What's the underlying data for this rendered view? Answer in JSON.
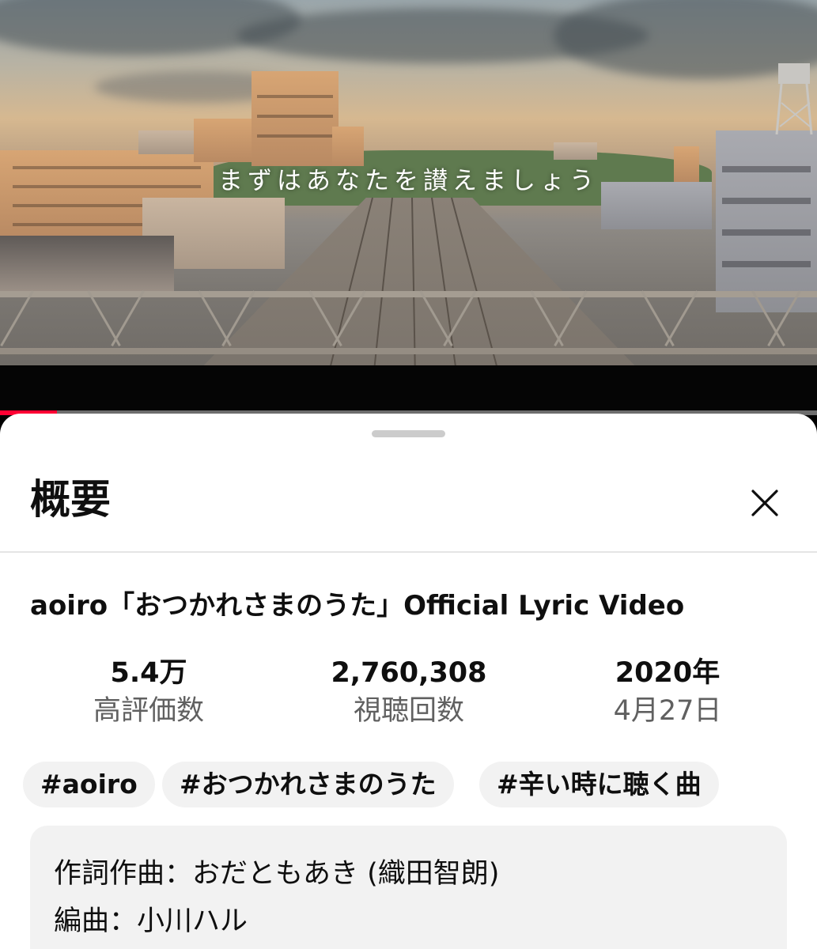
{
  "video": {
    "lyric_caption": "まずはあなたを讃えましょう",
    "progress_fraction": 0.07,
    "colors": {
      "progress": "#ff0033",
      "track": "#6d6d6d"
    }
  },
  "sheet": {
    "title": "概要",
    "close_icon": "close-icon",
    "video_title": "aoiro「おつかれさまのうた」Official Lyric Video",
    "stats": [
      {
        "value": "5.4万",
        "label": "高評価数"
      },
      {
        "value": "2,760,308",
        "label": "視聴回数"
      },
      {
        "value": "2020年",
        "label": "4月27日"
      }
    ],
    "tags": [
      "#aoiro",
      "#おつかれさまのうた",
      "#辛い時に聴く曲"
    ],
    "description": [
      "作詞作曲：おだともあき (織田智朗)",
      "編曲：小川ハル"
    ]
  }
}
